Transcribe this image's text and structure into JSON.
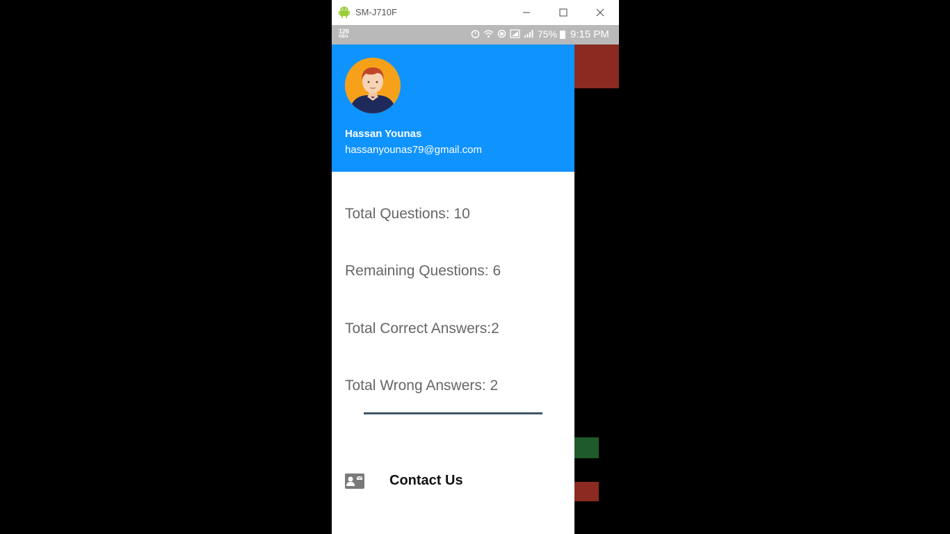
{
  "window": {
    "title": "SM-J710F",
    "minimize_icon": "minimize-icon",
    "maximize_icon": "maximize-icon",
    "close_icon": "close-icon"
  },
  "statusbar": {
    "speed_value": "126",
    "speed_unit": "KB/s",
    "battery_percent": "75%",
    "time": "9:15 PM"
  },
  "drawer": {
    "user_name": "Hassan Younas",
    "user_email": "hassanyounas79@gmail.com",
    "stats": {
      "total_questions": "Total Questions: 10",
      "remaining_questions": "Remaining Questions: 6",
      "correct_answers": "Total Correct Answers:2",
      "wrong_answers": "Total Wrong Answers: 2"
    },
    "contact_label": "Contact Us",
    "contact_icon": "contact-card-icon"
  },
  "colors": {
    "header_blue": "#0f93ff",
    "avatar_orange": "#f7a11a",
    "divider": "#3b5668"
  }
}
